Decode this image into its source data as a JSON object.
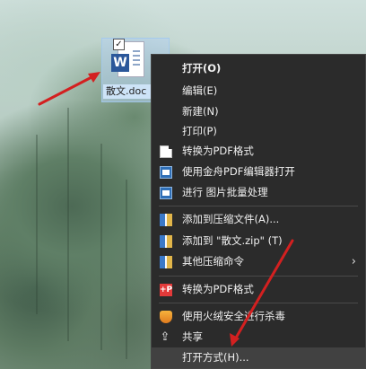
{
  "desktop": {
    "file": {
      "name": "散文.doc",
      "check_mark": "✓",
      "word_badge": "W"
    }
  },
  "context_menu": {
    "items": [
      {
        "label": "打开(O)",
        "icon": ""
      },
      {
        "label": "编辑(E)",
        "icon": ""
      },
      {
        "label": "新建(N)",
        "icon": ""
      },
      {
        "label": "打印(P)",
        "icon": ""
      },
      {
        "label": "转换为PDF格式",
        "icon": "document-icon"
      },
      {
        "label": "使用金舟PDF编辑器打开",
        "icon": "pdf-editor-icon"
      },
      {
        "label": "进行 图片批量处理",
        "icon": "image-batch-icon"
      },
      {
        "label": "添加到压缩文件(A)...",
        "icon": "archive-icon"
      },
      {
        "label": "添加到 \"散文.zip\" (T)",
        "icon": "archive-icon"
      },
      {
        "label": "其他压缩命令",
        "icon": "archive-icon",
        "submenu_glyph": "›"
      },
      {
        "label": "转换为PDF格式",
        "icon": "pdf-convert-icon",
        "icon_text": "+P"
      },
      {
        "label": "使用火绒安全进行杀毒",
        "icon": "shield-icon"
      },
      {
        "label": "共享",
        "icon": "share-icon",
        "icon_glyph": "⇪"
      },
      {
        "label": "打开方式(H)...",
        "icon": ""
      }
    ]
  },
  "colors": {
    "menu_background": "#2b2b2b",
    "menu_text": "#f0f0f0",
    "annotation_arrow": "#d32020"
  }
}
